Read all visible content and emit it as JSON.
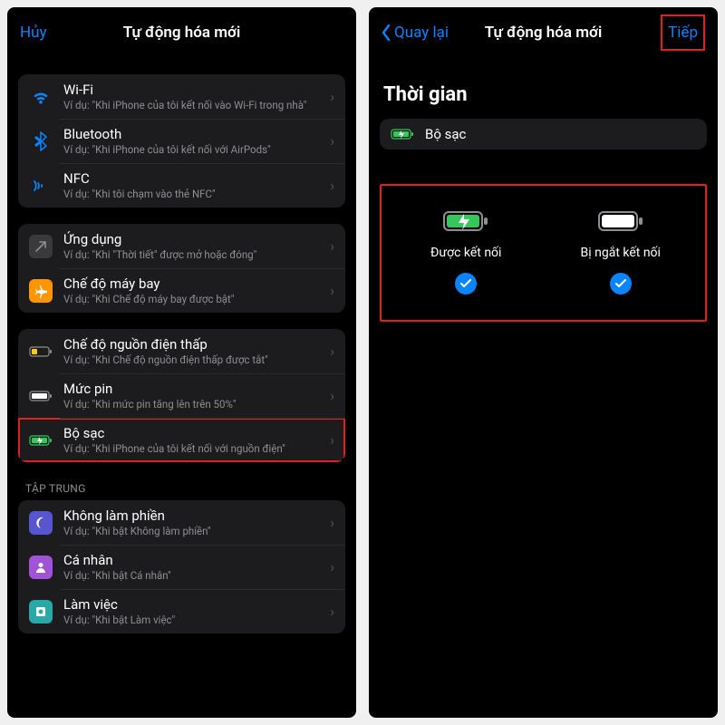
{
  "left": {
    "nav": {
      "cancel": "Hủy",
      "title": "Tự động hóa mới"
    },
    "groups": [
      [
        {
          "icon": "wifi",
          "title": "Wi-Fi",
          "sub": "Ví dụ: \"Khi iPhone của tôi kết nối vào Wi-Fi trong nhà\""
        },
        {
          "icon": "bluetooth",
          "title": "Bluetooth",
          "sub": "Ví dụ: \"Khi iPhone của tôi kết nối với AirPods\""
        },
        {
          "icon": "nfc",
          "title": "NFC",
          "sub": "Ví dụ: \"Khi tôi chạm vào thẻ NFC\""
        }
      ],
      [
        {
          "icon": "app",
          "title": "Ứng dụng",
          "sub": "Ví dụ: \"Khi \"Thời tiết\" được mở hoặc đóng\""
        },
        {
          "icon": "airplane",
          "title": "Chế độ máy bay",
          "sub": "Ví dụ: \"Khi Chế độ máy bay được bật\""
        }
      ],
      [
        {
          "icon": "lowpower",
          "title": "Chế độ nguồn điện thấp",
          "sub": "Ví dụ: \"Khi Chế độ nguồn điện thấp được tắt\""
        },
        {
          "icon": "battery",
          "title": "Mức pin",
          "sub": "Ví dụ: \"Khi mức pin tăng lên trên 50%\""
        },
        {
          "icon": "charger",
          "title": "Bộ sạc",
          "sub": "Ví dụ: \"Khi iPhone của tôi kết nối với nguồn điện\"",
          "highlight": true
        }
      ]
    ],
    "focusHeader": "TẬP TRUNG",
    "focusGroup": [
      {
        "icon": "moon",
        "title": "Không làm phiền",
        "sub": "Ví dụ: \"Khi bật Không làm phiền\""
      },
      {
        "icon": "person",
        "title": "Cá nhân",
        "sub": "Ví dụ: \"Khi bật Cá nhân\""
      },
      {
        "icon": "work",
        "title": "Làm việc",
        "sub": "Ví dụ: \"Khi bật Làm việc\""
      }
    ]
  },
  "right": {
    "nav": {
      "back": "Quay lại",
      "title": "Tự động hóa mới",
      "next": "Tiếp"
    },
    "heading": "Thời gian",
    "trigger": {
      "label": "Bộ sạc"
    },
    "options": {
      "connected": "Được kết nối",
      "disconnected": "Bị ngắt kết nối"
    }
  }
}
